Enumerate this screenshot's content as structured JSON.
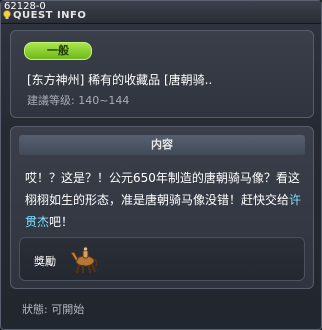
{
  "window": {
    "quest_id": "62128-0",
    "title": "QUEST INFO"
  },
  "quest": {
    "badge": "一般",
    "name": "[东方神州] 稀有的收藏品 [唐朝骑..",
    "level": "建議等级: 140~144"
  },
  "content": {
    "header": "内容",
    "text_before": "哎！？这是？！公元650年制造的唐朝骑马像？看这栩栩如生的形态，准是唐朝骑马像没错！赶快交给",
    "npc": "许贯杰",
    "text_after": "吧！"
  },
  "reward": {
    "label": "獎勵",
    "item_icon": "tang-horse-statue-icon"
  },
  "status": {
    "text": "狀態: 可開始"
  },
  "colors": {
    "badge": "#8fd12e",
    "npc_highlight": "#7fe0ff",
    "panel": "#343944"
  }
}
